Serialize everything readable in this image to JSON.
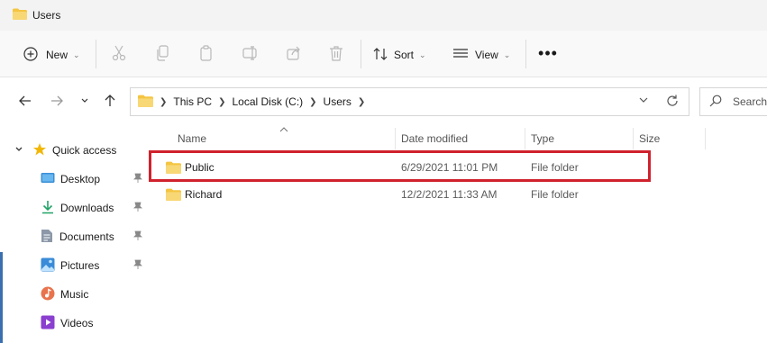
{
  "window": {
    "title": "Users"
  },
  "toolbar": {
    "new_label": "New",
    "sort_label": "Sort",
    "view_label": "View",
    "more_label": "•••",
    "icons": [
      "cut-icon",
      "copy-icon",
      "paste-icon",
      "rename-icon",
      "share-icon",
      "delete-icon"
    ]
  },
  "navigation": {
    "breadcrumb": [
      "This PC",
      "Local Disk (C:)",
      "Users"
    ],
    "search_placeholder": "Search"
  },
  "sidebar": {
    "items": [
      {
        "label": "Quick access",
        "icon": "star-icon",
        "pinned": false
      },
      {
        "label": "Desktop",
        "icon": "desktop-icon",
        "pinned": true
      },
      {
        "label": "Downloads",
        "icon": "download-icon",
        "pinned": true
      },
      {
        "label": "Documents",
        "icon": "document-icon",
        "pinned": true
      },
      {
        "label": "Pictures",
        "icon": "pictures-icon",
        "pinned": true
      },
      {
        "label": "Music",
        "icon": "music-icon",
        "pinned": false
      },
      {
        "label": "Videos",
        "icon": "videos-icon",
        "pinned": false
      }
    ]
  },
  "file_list": {
    "columns": [
      "Name",
      "Date modified",
      "Type",
      "Size"
    ],
    "rows": [
      {
        "name": "Public",
        "date": "6/29/2021 11:01 PM",
        "type": "File folder",
        "size": ""
      },
      {
        "name": "Richard",
        "date": "12/2/2021 11:33 AM",
        "type": "File folder",
        "size": ""
      }
    ]
  },
  "colors": {
    "folder": "#f4c542",
    "highlight": "#d0222d",
    "accent": "#0067c0"
  }
}
